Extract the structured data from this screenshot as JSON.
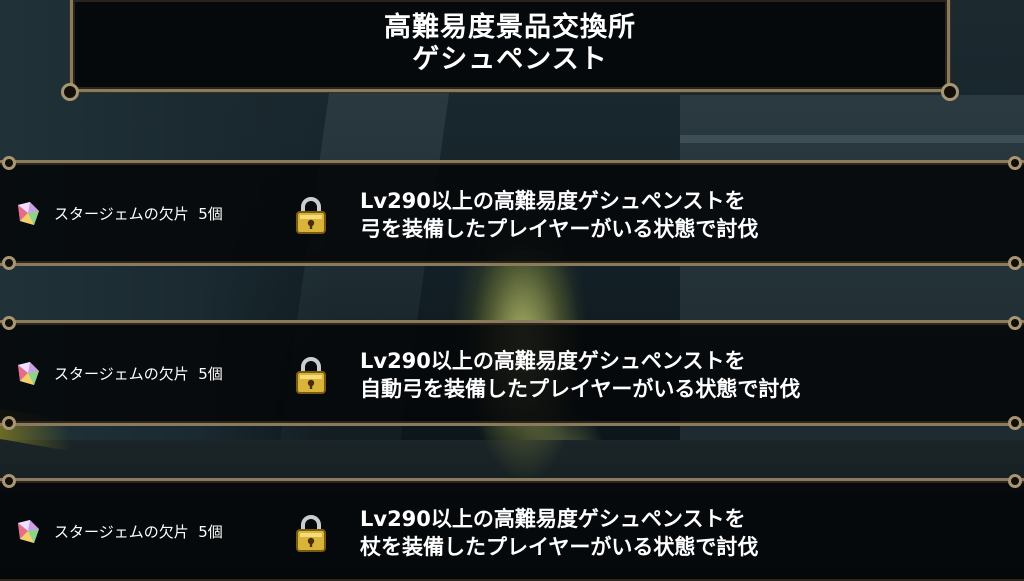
{
  "header": {
    "title_line1": "高難易度景品交換所",
    "title_line2": "ゲシュペンスト"
  },
  "rewards": [
    {
      "item": "スタージェムの欠片",
      "quantity": "5個",
      "locked": true,
      "condition_line1": "Lv290以上の高難易度ゲシュペンストを",
      "condition_line2": "弓を装備したプレイヤーがいる状態で討伐"
    },
    {
      "item": "スタージェムの欠片",
      "quantity": "5個",
      "locked": true,
      "condition_line1": "Lv290以上の高難易度ゲシュペンストを",
      "condition_line2": "自動弓を装備したプレイヤーがいる状態で討伐"
    },
    {
      "item": "スタージェムの欠片",
      "quantity": "5個",
      "locked": true,
      "condition_line1": "Lv290以上の高難易度ゲシュペンストを",
      "condition_line2": "杖を装備したプレイヤーがいる状態で討伐"
    }
  ],
  "icons": {
    "gem": "star-gem-shard-icon",
    "lock": "padlock-icon"
  },
  "colors": {
    "frame": "#8a7a5e",
    "panel": "#06090b",
    "text": "#ffffff",
    "lock_gold": "#d9b43a"
  }
}
